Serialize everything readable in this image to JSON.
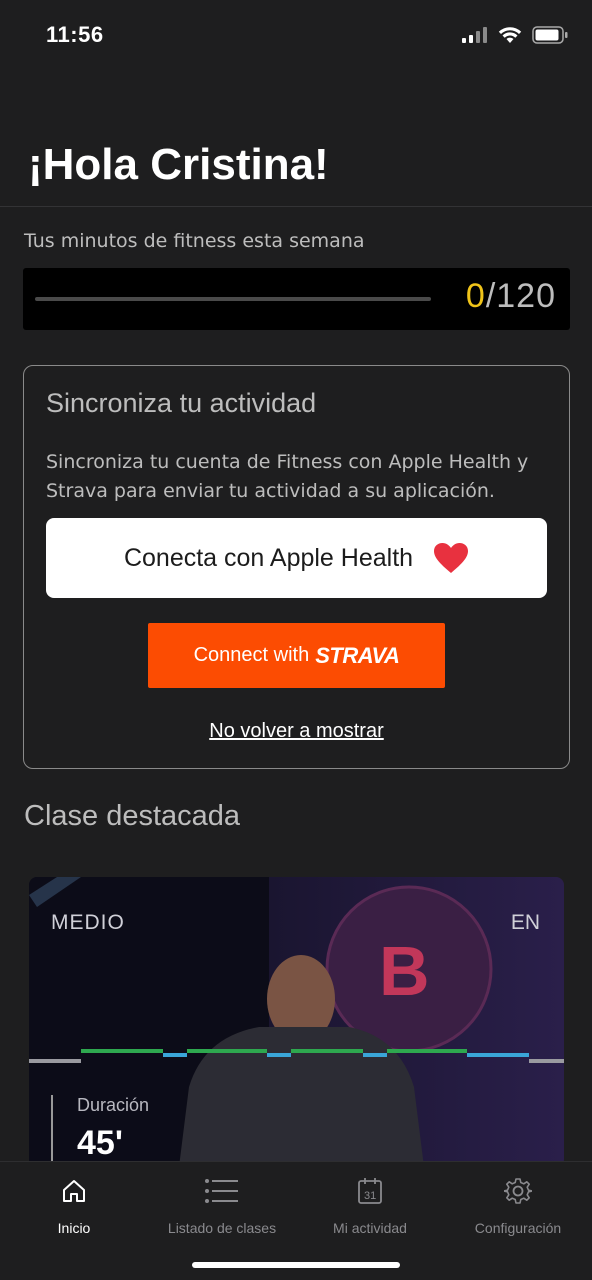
{
  "status_bar": {
    "time": "11:56"
  },
  "greeting": "¡Hola Cristina!",
  "fitness": {
    "label": "Tus minutos de fitness esta semana",
    "current": "0",
    "separator": "/",
    "goal": "120",
    "progress_fraction": 0
  },
  "sync_card": {
    "title": "Sincroniza tu actividad",
    "description": "Sincroniza tu cuenta de Fitness con Apple Health y Strava para enviar tu actividad a su aplicación.",
    "apple_button_label": "Conecta con Apple Health",
    "apple_button_icon": "heart-icon",
    "strava_connect_text": "Connect with",
    "strava_logo_text": "STRAVA",
    "dismiss_label": "No volver a mostrar"
  },
  "featured": {
    "section_title": "Clase destacada",
    "level": "MEDIO",
    "language": "EN",
    "duration_label": "Duración",
    "duration_value": "45'"
  },
  "tab_bar": {
    "items": [
      {
        "label": "Inicio",
        "icon": "home-icon",
        "active": true
      },
      {
        "label": "Listado de clases",
        "icon": "list-icon",
        "active": false
      },
      {
        "label": "Mi actividad",
        "icon": "calendar-icon",
        "active": false
      },
      {
        "label": "Configuración",
        "icon": "gear-icon",
        "active": false
      }
    ]
  },
  "colors": {
    "background": "#1e1e1f",
    "accent_yellow": "#f0c419",
    "strava_orange": "#fc4c02",
    "heart_red": "#e8313f"
  }
}
